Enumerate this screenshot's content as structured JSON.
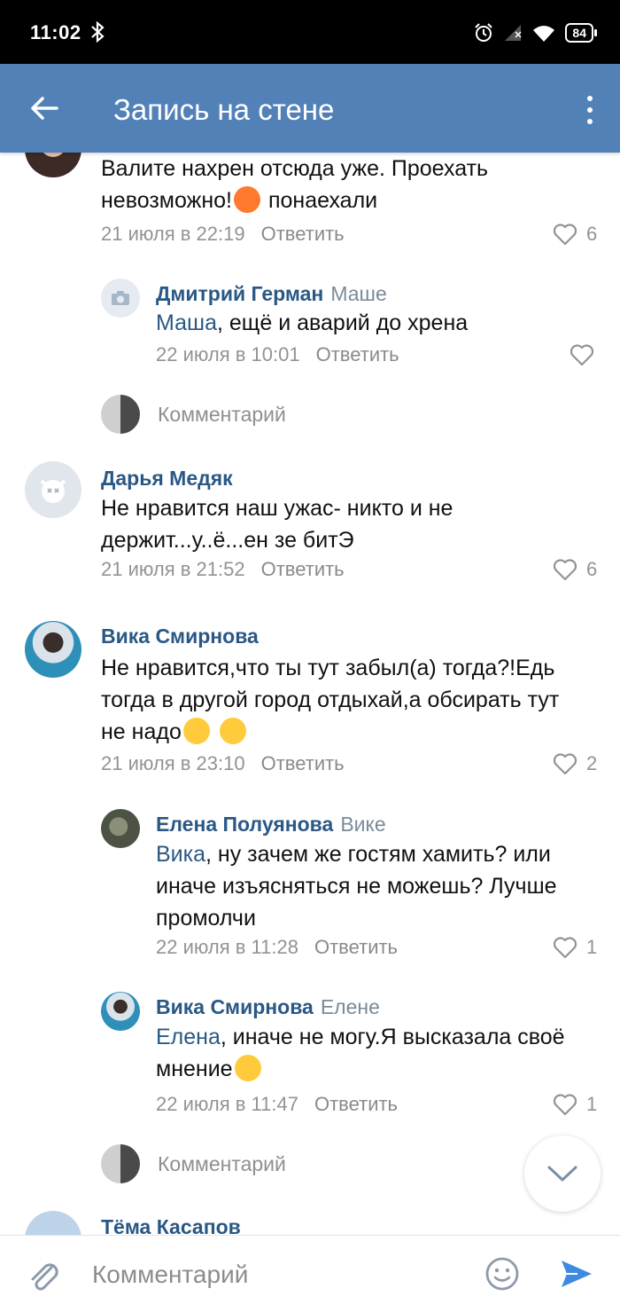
{
  "status_bar": {
    "time": "11:02",
    "battery": "84"
  },
  "header": {
    "title": "Запись на стене"
  },
  "comments": [
    {
      "text": "Валите нахрен отсюда уже. Проехать",
      "text2": "невозможно!",
      "text3": "понаехали",
      "date": "21 июля в 22:19",
      "reply": "Ответить",
      "likes": "6"
    },
    {
      "name": "Дмитрий Герман",
      "reply_to": "Маше",
      "mention": "Маша",
      "text": ", ещё и аварий до хрена",
      "date": "22 июля в 10:01",
      "reply": "Ответить",
      "likes": ""
    },
    {
      "name": "Дарья Медяк",
      "text": "Не нравится наш ужас- никто и не",
      "text2": "держит...у..ё...ен зе битЭ",
      "date": "21 июля в 21:52",
      "reply": "Ответить",
      "likes": "6"
    },
    {
      "name": "Вика Смирнова",
      "text": "Не нравится,что ты тут забыл(а) тогда?!Едь",
      "text2": "тогда в другой город отдыхай,а обсирать тут",
      "text3": "не надо",
      "date": "21 июля в 23:10",
      "reply": "Ответить",
      "likes": "2"
    },
    {
      "name": "Елена Полуянова",
      "reply_to": "Вике",
      "mention": "Вика",
      "text": ", ну зачем же гостям хамить? или",
      "text2": "иначе изъясняться не можешь? Лучше",
      "text3": "промолчи",
      "date": "22 июля в 11:28",
      "reply": "Ответить",
      "likes": "1"
    },
    {
      "name": "Вика Смирнова",
      "reply_to": "Елене",
      "mention": "Елена",
      "text": ", иначе не могу.Я высказала своё",
      "text2": "мнение",
      "date": "22 июля в 11:47",
      "reply": "Ответить",
      "likes": "1"
    },
    {
      "name": "Тёма Касапов"
    }
  ],
  "sub_comment_placeholder": "Комментарий",
  "input": {
    "placeholder": "Комментарий"
  },
  "colors": {
    "header_bg": "#5281b8",
    "link": "#2a5885",
    "meta": "#939393",
    "send": "#3f8ae0"
  }
}
